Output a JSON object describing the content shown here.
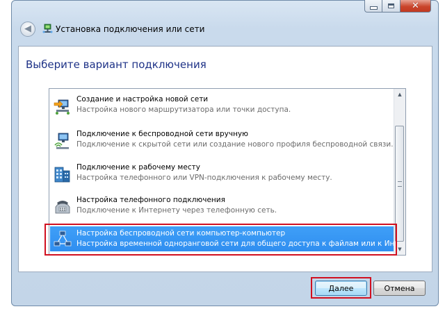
{
  "window": {
    "title": "Установка подключения или сети",
    "colors": {
      "heading": "#1e3287",
      "selection": "#3399ff",
      "highlight": "#d10f1f"
    }
  },
  "heading": "Выберите вариант подключения",
  "options": [
    {
      "title": "Создание и настройка новой сети",
      "description": "Настройка нового маршрутизатора или точки доступа.",
      "icon": "network-setup-icon",
      "selected": false
    },
    {
      "title": "Подключение к беспроводной сети вручную",
      "description": "Подключение к скрытой сети или создание нового профиля беспроводной связи.",
      "icon": "wireless-network-icon",
      "selected": false
    },
    {
      "title": "Подключение к рабочему месту",
      "description": "Настройка телефонного или VPN-подключения к рабочему месту.",
      "icon": "workplace-building-icon",
      "selected": false
    },
    {
      "title": "Настройка телефонного подключения",
      "description": "Подключение к Интернету через телефонную сеть.",
      "icon": "dialup-phone-icon",
      "selected": false
    },
    {
      "title": "Настройка беспроводной сети компьютер-компьютер",
      "description": "Настройка временной одноранговой сети для общего доступа к файлам или к Инт...",
      "icon": "adhoc-network-icon",
      "selected": true
    }
  ],
  "buttons": {
    "next": "Далее",
    "cancel": "Отмена"
  }
}
